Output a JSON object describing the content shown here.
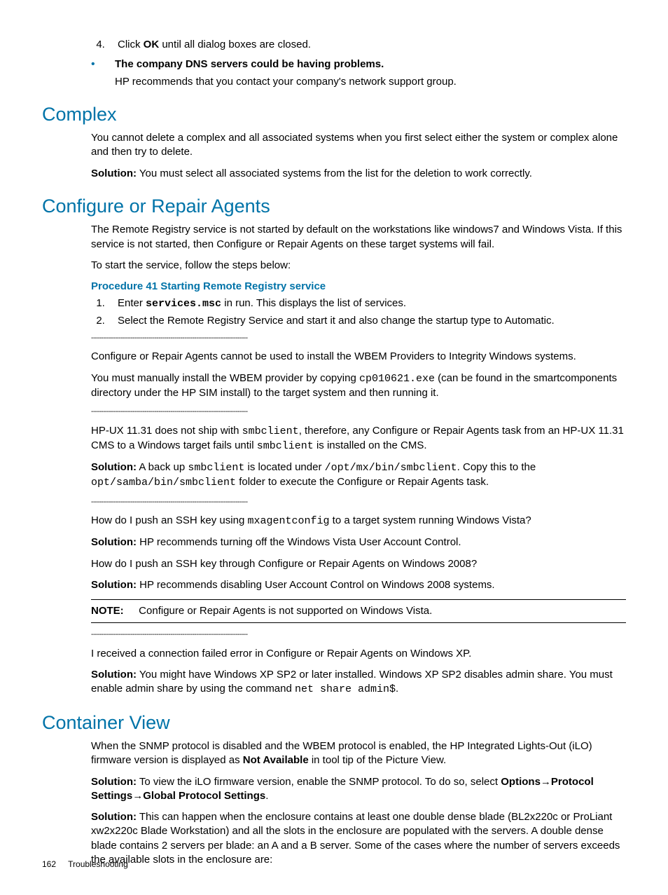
{
  "top": {
    "step4_prefix": "Click ",
    "step4_bold": "OK",
    "step4_suffix": " until all dialog boxes are closed.",
    "bullet_bold": "The company DNS servers could be having problems.",
    "bullet_desc": "HP recommends that you contact your company's network support group."
  },
  "complex": {
    "heading": "Complex",
    "p1": "You cannot delete a complex and all associated systems when you first select either the system or complex alone and then try to delete.",
    "sol_label": "Solution:",
    "sol_text": " You must select all associated systems from the list for the deletion to work correctly."
  },
  "cra": {
    "heading": "Configure or Repair Agents",
    "p1": "The Remote Registry service is not started by default on the workstations like windows7 and Windows Vista. If this service is not started, then Configure or Repair Agents on these target systems will fail.",
    "p2": "To start the service, follow the steps below:",
    "proc_title": "Procedure 41 Starting Remote Registry service",
    "step1_a": "Enter ",
    "step1_code": "services.msc",
    "step1_b": " in run. This displays the list of services.",
    "step2": "Select the Remote Registry Service and start it and also change the startup type to Automatic.",
    "sep": "-------------------------------------------------------------------------------",
    "blk2_p1": "Configure or Repair Agents cannot be used to install the WBEM Providers to Integrity Windows systems.",
    "blk2_p2a": "You must manually install the WBEM provider by copying ",
    "blk2_code": "cp010621.exe",
    "blk2_p2b": " (can be found in the smartcomponents directory under the HP SIM install) to the target system and then running it.",
    "blk3_p1a": "HP-UX 11.31 does not ship with ",
    "blk3_c1": "smbclient",
    "blk3_p1b": ", therefore, any Configure or Repair Agents task from an HP-UX 11.31 CMS to a Windows target fails until ",
    "blk3_c2": "smbclient",
    "blk3_p1c": " is installed on the CMS.",
    "blk3_sol_label": "Solution:",
    "blk3_sol_a": " A back up ",
    "blk3_sol_c1": "smbclient",
    "blk3_sol_b": " is located under ",
    "blk3_sol_c2": "/opt/mx/bin/smbclient",
    "blk3_sol_c": ". Copy this to the ",
    "blk3_sol_c3": "opt/samba/bin/smbclient",
    "blk3_sol_d": " folder to execute the Configure or Repair Agents task.",
    "blk4_q1a": "How do I push an SSH key using ",
    "blk4_q1_code": "mxagentconfig",
    "blk4_q1b": " to a target system running Windows Vista?",
    "blk4_sol1_label": "Solution:",
    "blk4_sol1_text": " HP recommends turning off the Windows Vista User Account Control.",
    "blk4_q2": "How do I push an SSH key through Configure or Repair Agents on Windows 2008?",
    "blk4_sol2_label": "Solution:",
    "blk4_sol2_text": " HP recommends disabling User Account Control on Windows 2008 systems.",
    "note_label": "NOTE:",
    "note_text": "Configure or Repair Agents is not supported on Windows Vista.",
    "blk5_p1": "I received a connection failed error in Configure or Repair Agents on Windows XP.",
    "blk5_sol_label": "Solution:",
    "blk5_sol_a": " You might have Windows XP SP2 or later installed. Windows XP SP2 disables admin share. You must enable admin share by using the command ",
    "blk5_sol_code": "net share admin$",
    "blk5_sol_b": "."
  },
  "cv": {
    "heading": "Container View",
    "p1a": "When the SNMP protocol is disabled and the WBEM protocol is enabled, the HP Integrated Lights-Out (iLO) firmware version is displayed as ",
    "p1_bold": "Not Available",
    "p1b": " in tool tip of the Picture View.",
    "sol1_label": "Solution:",
    "sol1_a": " To view the iLO firmware version, enable the SNMP protocol. To do so, select ",
    "sol1_b1": "Options",
    "sol1_arrow": "→",
    "sol1_b2": "Protocol Settings",
    "sol1_b3": "Global Protocol Settings",
    "sol1_end": ".",
    "sol2_label": "Solution:",
    "sol2_text": " This can happen when the enclosure contains at least one double dense blade (BL2x220c or ProLiant xw2x220c Blade Workstation) and all the slots in the enclosure are populated with the servers. A double dense blade contains 2 servers per blade: an A and a B server. Some of the cases where the number of servers exceeds the available slots in the enclosure are:"
  },
  "footer": {
    "page": "162",
    "section": "Troubleshooting"
  }
}
